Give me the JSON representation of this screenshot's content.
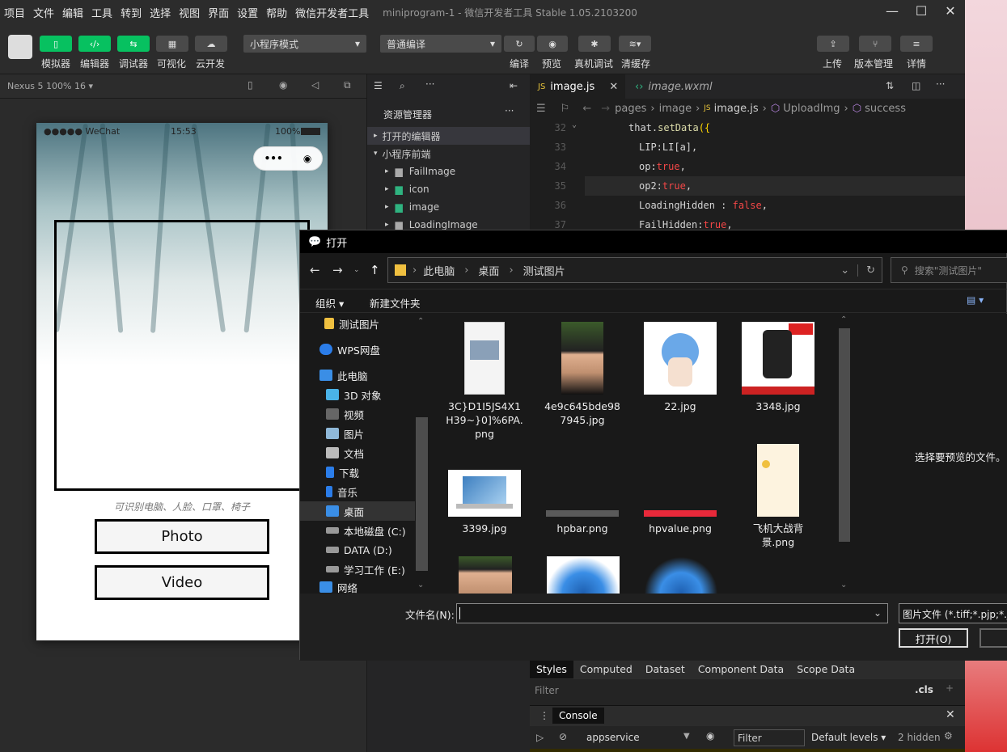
{
  "menu": {
    "items": [
      "项目",
      "文件",
      "编辑",
      "工具",
      "转到",
      "选择",
      "视图",
      "界面",
      "设置",
      "帮助",
      "微信开发者工具"
    ],
    "window_title": "miniprogram-1 - 微信开发者工具 Stable 1.05.2103200"
  },
  "toolbar": {
    "simulator": "模拟器",
    "editor": "编辑器",
    "debugger": "调试器",
    "visual": "可视化",
    "cloud": "云开发",
    "mode": "小程序模式",
    "compile": "普通编译",
    "compile_btn": "编译",
    "preview": "预览",
    "device_debug": "真机调试",
    "clear_cache": "清缓存",
    "upload": "上传",
    "version": "版本管理",
    "details": "详情"
  },
  "simulator": {
    "device": "Nexus 5 100% 16 ▾"
  },
  "phone": {
    "carrier": "●●●●● WeChat",
    "time": "15:53",
    "battery": "100%",
    "hint": "可识别电脑、人脸、口罩、椅子",
    "photo_btn": "Photo",
    "video_btn": "Video"
  },
  "explorer": {
    "title": "资源管理器",
    "open_editors": "打开的编辑器",
    "project": "小程序前端",
    "folders": [
      "FailImage",
      "icon",
      "image",
      "LoadingImage"
    ]
  },
  "editor": {
    "tabs": [
      "image.js",
      "image.wxml"
    ],
    "breadcrumb": [
      "pages",
      "image",
      "image.js",
      "UploadImg",
      "success"
    ],
    "line_numbers": [
      "32",
      "33",
      "34",
      "35",
      "36",
      "37"
    ],
    "lines": {
      "l32a": "that.",
      "l32b": "setData",
      "l32c": "({",
      "l33": "LIP:LI[a],",
      "l34a": "op:",
      "l34b": "true",
      "l34c": ",",
      "l35a": "op2:",
      "l35b": "true",
      "l35c": ",",
      "l36a": "LoadingHidden : ",
      "l36b": "false",
      "l36c": ",",
      "l37a": "FailHidden:",
      "l37b": "true",
      "l37c": ","
    }
  },
  "devtools": {
    "tabs": [
      "Styles",
      "Computed",
      "Dataset",
      "Component Data",
      "Scope Data"
    ],
    "filter": "Filter",
    "cls": ".cls",
    "console": "Console",
    "context": "appservice",
    "filter2": "Filter",
    "levels": "Default levels ▾",
    "hidden": "2 hidden"
  },
  "dialog": {
    "title": "打开",
    "path": [
      "此电脑",
      "桌面",
      "测试图片"
    ],
    "search_placeholder": "搜索\"测试图片\"",
    "organize": "组织 ▾",
    "new_folder": "新建文件夹",
    "nav": [
      "测试图片",
      "WPS网盘",
      "此电脑",
      "3D 对象",
      "视频",
      "图片",
      "文档",
      "下载",
      "音乐",
      "桌面",
      "本地磁盘 (C:)",
      "DATA (D:)",
      "学习工作 (E:)",
      "网络"
    ],
    "files": [
      {
        "name": "3C}D1I5JS4X1H39~}0]%6PA.png"
      },
      {
        "name": "4e9c645bde987945.jpg"
      },
      {
        "name": "22.jpg"
      },
      {
        "name": "3348.jpg"
      },
      {
        "name": "3399.jpg"
      },
      {
        "name": "hpbar.png"
      },
      {
        "name": "hpvalue.png"
      },
      {
        "name": "飞机大战背景.png"
      }
    ],
    "preview_text": "选择要预览的文件。",
    "filename_label": "文件名(N):",
    "filetype": "图片文件 (*.tiff;*.pjp;*.jfi",
    "open_btn": "打开(O)"
  }
}
